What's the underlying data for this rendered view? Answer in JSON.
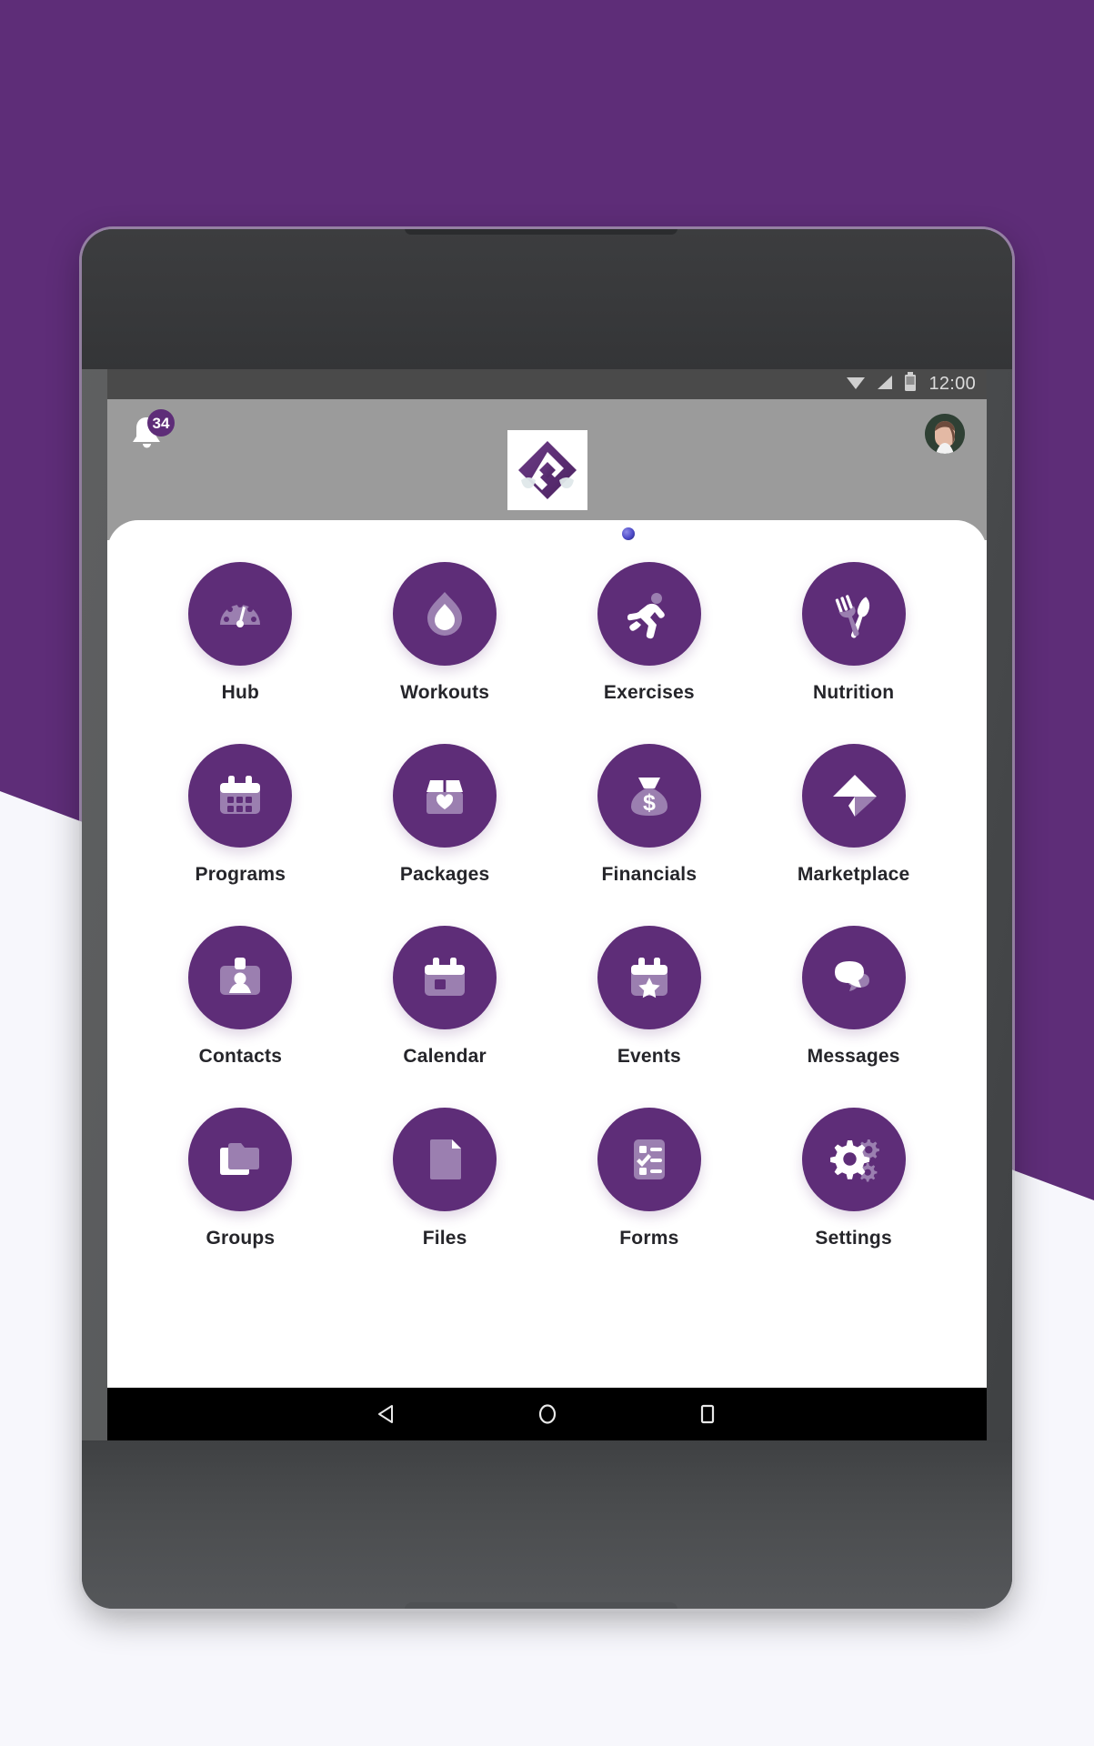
{
  "theme": {
    "brand_purple": "#5E2D78",
    "icon_light_purple": "#9B7FB0",
    "icon_white": "#FFFFFF",
    "page_background": "#F7F7FC",
    "header_gray": "#9B9B9B",
    "status_bar_gray": "#4A4A4A",
    "label_color": "#25252A"
  },
  "status_bar": {
    "time": "12:00",
    "icons": [
      "wifi-icon",
      "cellular-signal-icon",
      "battery-icon"
    ]
  },
  "app_header": {
    "notification": {
      "icon": "bell-icon",
      "badge_count": "34"
    },
    "logo": {
      "icon": "app-logo-diamond-icon",
      "alt": "App logo"
    },
    "avatar": {
      "icon": "avatar-icon"
    }
  },
  "home_grid": {
    "tiles": [
      {
        "label": "Hub",
        "icon": "speedometer-icon"
      },
      {
        "label": "Workouts",
        "icon": "flame-icon"
      },
      {
        "label": "Exercises",
        "icon": "running-person-icon"
      },
      {
        "label": "Nutrition",
        "icon": "fork-knife-icon"
      },
      {
        "label": "Programs",
        "icon": "calendar-dots-icon"
      },
      {
        "label": "Packages",
        "icon": "box-heart-icon"
      },
      {
        "label": "Financials",
        "icon": "money-bag-icon"
      },
      {
        "label": "Marketplace",
        "icon": "paper-plane-icon"
      },
      {
        "label": "Contacts",
        "icon": "id-badge-icon"
      },
      {
        "label": "Calendar",
        "icon": "calendar-icon"
      },
      {
        "label": "Events",
        "icon": "calendar-star-icon"
      },
      {
        "label": "Messages",
        "icon": "chat-bubbles-icon"
      },
      {
        "label": "Groups",
        "icon": "folders-icon"
      },
      {
        "label": "Files",
        "icon": "document-icon"
      },
      {
        "label": "Forms",
        "icon": "checklist-clipboard-icon"
      },
      {
        "label": "Settings",
        "icon": "gears-icon"
      }
    ]
  },
  "nav_bar": {
    "buttons": [
      {
        "name": "back-button",
        "icon": "back-triangle-icon"
      },
      {
        "name": "home-button",
        "icon": "home-circle-icon"
      },
      {
        "name": "recents-button",
        "icon": "recents-square-icon"
      }
    ]
  }
}
